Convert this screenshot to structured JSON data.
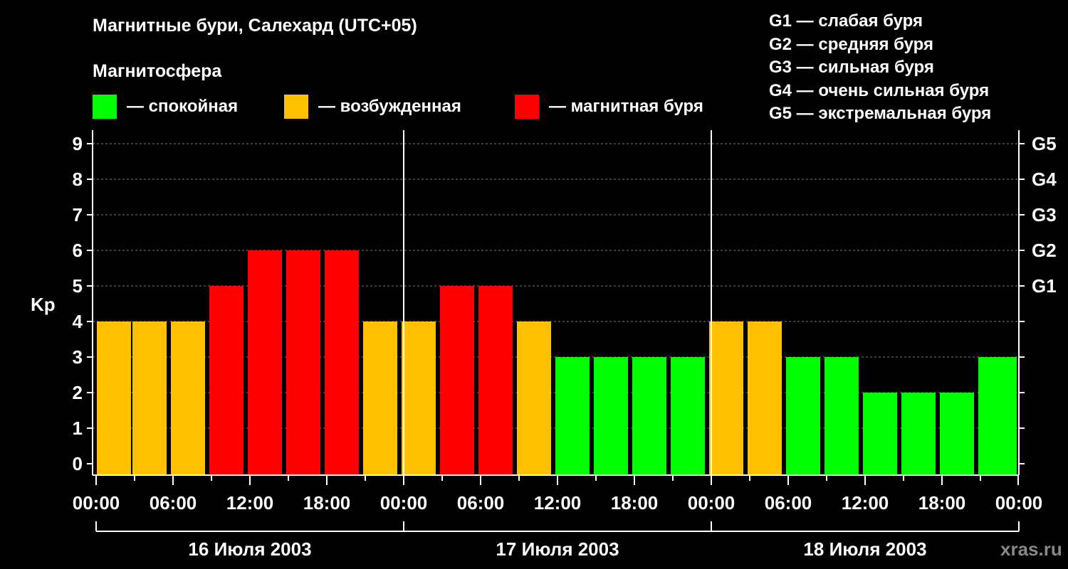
{
  "header": {
    "title": "Магнитные бури, Салехард (UTC+05)",
    "subtitle": "Магнитосфера"
  },
  "legend": [
    {
      "label": "— спокойная",
      "color": "#00ff00"
    },
    {
      "label": "— возбужденная",
      "color": "#ffc000"
    },
    {
      "label": "— магнитная буря",
      "color": "#ff0000"
    }
  ],
  "g_scale": [
    "G1 — слабая буря",
    "G2 — средняя буря",
    "G3 — сильная буря",
    "G4 — очень сильная буря",
    "G5 — экстремальная буря"
  ],
  "watermark": "xras.ru",
  "chart_data": {
    "type": "bar",
    "ylabel": "Kp",
    "ylim": [
      0,
      9
    ],
    "yticks": [
      "0",
      "1",
      "2",
      "3",
      "4",
      "5",
      "6",
      "7",
      "8",
      "9"
    ],
    "right_ticks": [
      {
        "value": 5,
        "label": "G1"
      },
      {
        "value": 6,
        "label": "G2"
      },
      {
        "value": 7,
        "label": "G3"
      },
      {
        "value": 8,
        "label": "G4"
      },
      {
        "value": 9,
        "label": "G5"
      }
    ],
    "x_tick_labels": [
      "00:00",
      "06:00",
      "12:00",
      "18:00",
      "00:00",
      "06:00",
      "12:00",
      "18:00",
      "00:00",
      "06:00",
      "12:00",
      "18:00",
      "00:00"
    ],
    "days": [
      "16 Июля 2003",
      "17 Июля 2003",
      "18 Июля 2003"
    ],
    "interval_hours": 3,
    "values": [
      4,
      4,
      4,
      5,
      6,
      6,
      6,
      4,
      4,
      5,
      5,
      4,
      3,
      3,
      3,
      3,
      4,
      4,
      3,
      3,
      2,
      2,
      2,
      3
    ],
    "partial_last_bar_value": 3,
    "category_colors": {
      "quiet": "#00ff00",
      "active": "#ffc000",
      "storm": "#ff0000"
    },
    "grid": "dashed horizontal"
  }
}
